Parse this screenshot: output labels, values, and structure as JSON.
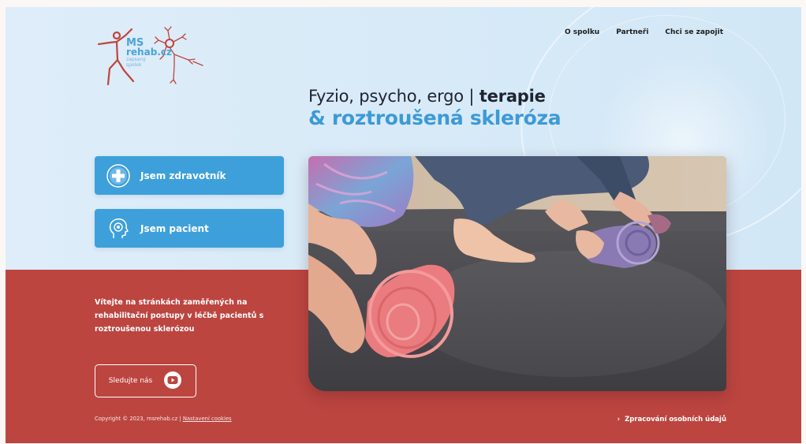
{
  "nav": {
    "items": [
      "O spolku",
      "Partneři",
      "Chci se zapojit"
    ]
  },
  "logo": {
    "ms": "MS",
    "rehab": "rehab.cz",
    "sub1": "zapsaný",
    "sub2": "spolek"
  },
  "headline": {
    "line1_regular": "Fyzio, psycho, ergo | ",
    "line1_bold": "terapie",
    "line2": "& roztroušená skleróza"
  },
  "cta": {
    "professional": "Jsem zdravotník",
    "patient": "Jsem pacient"
  },
  "welcome": {
    "text": "Vítejte na stránkách zaměřených na rehabilitační postupy v léčbě pacientů s roztroušenou sklerózou"
  },
  "follow": {
    "label": "Sledujte nás",
    "icon": "youtube-icon"
  },
  "footer": {
    "copyright": "Copyright © 2023, msrehab.cz | ",
    "cookies_link": "Nastavení cookies",
    "privacy_link": "Zpracování osobních údajů"
  },
  "colors": {
    "blue_accent": "#3ea0da",
    "headline_blue": "#3d9ad5",
    "brick_red": "#bc4540",
    "sky": "#d8eaf8"
  }
}
